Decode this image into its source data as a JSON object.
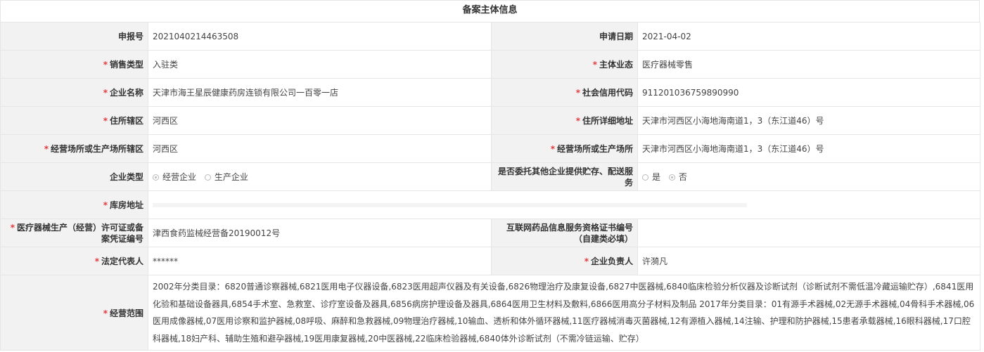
{
  "title": "备案主体信息",
  "required_mark": "*",
  "rows": [
    {
      "l1": "申报号",
      "v1": "2021040214463508",
      "l2": "申请日期",
      "v2": "2021-04-02"
    },
    {
      "l1": "销售类型",
      "v1": "入驻类",
      "l2": "主体业态",
      "v2": "医疗器械零售"
    },
    {
      "l1": "企业名称",
      "v1": "天津市海王星辰健康药房连锁有限公司一百零一店",
      "l2": "社会信用代码",
      "v2": "911201036759890990"
    },
    {
      "l1": "住所辖区",
      "v1": "河西区",
      "l2": "住所详细地址",
      "v2": "天津市河西区小海地海南道1，3（东江道46）号"
    },
    {
      "l1": "经营场所或生产场所辖区",
      "v1": "河西区",
      "l2": "经营场所或生产场所",
      "v2": "天津市河西区小海地海南道1，3（东江道46）号"
    }
  ],
  "enterprise_type": {
    "label": "企业类型",
    "options": [
      "经营企业",
      "生产企业"
    ],
    "selected": "经营企业"
  },
  "consign": {
    "label": "是否委托其他企业提供贮存、配送服务",
    "options": [
      "是",
      "否"
    ],
    "selected": "否"
  },
  "warehouse": {
    "label": "库房地址",
    "value": ""
  },
  "license": {
    "label": "医疗器械生产（经营）许可证或备案凭证编号",
    "value": "津西食药监械经营备20190012号"
  },
  "internet": {
    "label": "互联网药品信息服务资格证书编号（自建类必填）",
    "value": ""
  },
  "legal": {
    "l1": "法定代表人",
    "v1": "******",
    "l2": "企业负责人",
    "v2": "许漪凡"
  },
  "scope": {
    "label": "经营范围",
    "value": "2002年分类目录：6820普通诊察器械,6821医用电子仪器设备,6823医用超声仪器及有关设备,6826物理治疗及康复设备,6827中医器械,6840临床检验分析仪器及诊断试剂（诊断试剂不需低温冷藏运输贮存）,6841医用化验和基础设备器具,6854手术室、急救室、诊疗室设备及器具,6856病房护理设备及器具,6864医用卫生材料及敷料,6866医用高分子材料及制品 2017年分类目录：01有源手术器械,02无源手术器械,04骨科手术器械,06医用成像器械,07医用诊察和监护器械,08呼吸、麻醉和急救器械,09物理治疗器械,10输血、透析和体外循环器械,11医疗器械消毒灭菌器械,12有源植入器械,14注输、护理和防护器械,15患者承载器械,16眼科器械,17口腔科器械,18妇产科、辅助生殖和避孕器械,19医用康复器械,20中医器械,22临床检验器械,6840体外诊断试剂（不需冷链运输、贮存）"
  }
}
